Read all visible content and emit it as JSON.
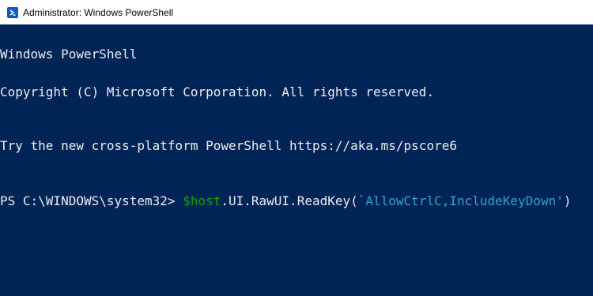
{
  "window": {
    "title": "Administrator: Windows PowerShell",
    "app_icon": "powershell-icon"
  },
  "console": {
    "lines": [
      "Windows PowerShell",
      "Copyright (C) Microsoft Corporation. All rights reserved.",
      "Try the new cross-platform PowerShell https://aka.ms/pscore6"
    ],
    "prompt": "PS C:\\WINDOWS\\system32> ",
    "command": {
      "variable": "$host",
      "member": ".UI.RawUI.ReadKey(",
      "argument": "`AllowCtrlC,IncludeKeyDown'",
      "closing": ")"
    }
  },
  "colors": {
    "background": "#012456",
    "text": "#eeedf0",
    "variable": "#13a10e",
    "string": "#2fa6c8"
  }
}
